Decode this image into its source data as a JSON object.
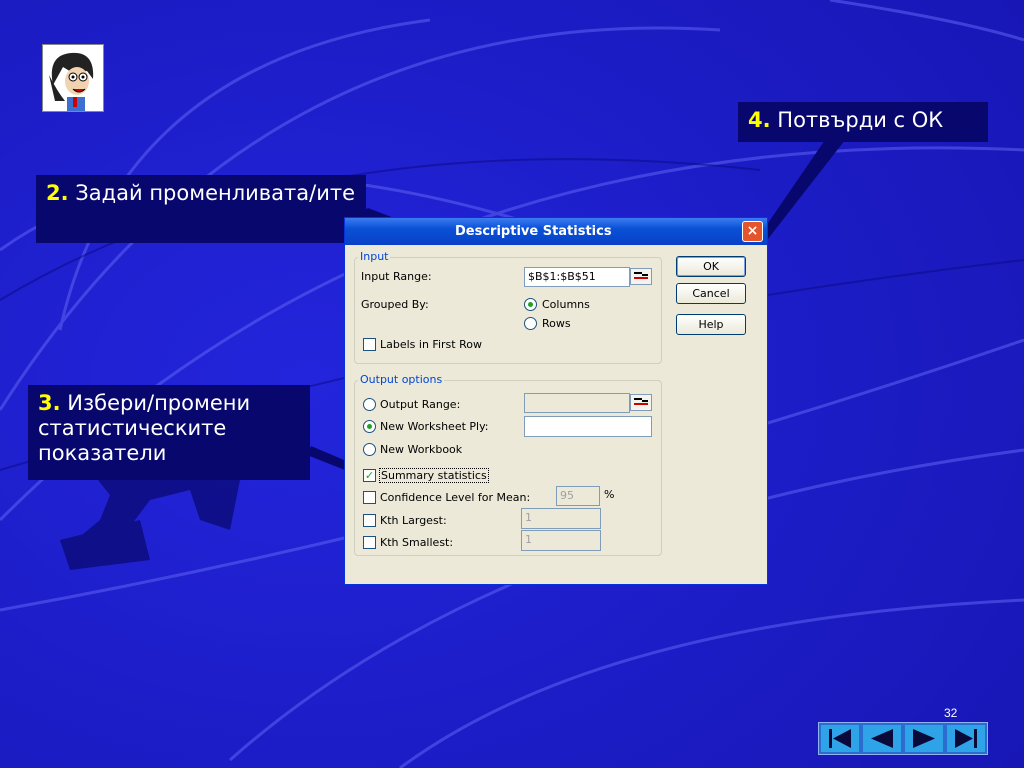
{
  "callouts": {
    "step2": {
      "num": "2.",
      "text": "Задай променливата/ите"
    },
    "step3": {
      "num": "3.",
      "text": "Избери/промени статистическите показатели"
    },
    "step4": {
      "num": "4.",
      "text": "Потвърди с ОК"
    }
  },
  "dialog": {
    "title": "Descriptive Statistics",
    "close_glyph": "×",
    "input_group": {
      "legend": "Input",
      "input_range_label": "Input Range:",
      "input_range_value": "$B$1:$B$51",
      "grouped_by_label": "Grouped By:",
      "columns_label": "Columns",
      "rows_label": "Rows",
      "labels_first_row": "Labels in First Row"
    },
    "output_group": {
      "legend": "Output options",
      "output_range_label": "Output Range:",
      "new_ply_label": "New Worksheet Ply:",
      "new_workbook_label": "New Workbook",
      "summary_label": "Summary statistics",
      "summary_checked": true,
      "confidence_label": "Confidence Level for Mean:",
      "confidence_value": "95",
      "percent": "%",
      "kth_largest_label": "Kth Largest:",
      "kth_largest_value": "1",
      "kth_smallest_label": "Kth Smallest:",
      "kth_smallest_value": "1"
    },
    "buttons": {
      "ok": "OK",
      "cancel": "Cancel",
      "help": "Help"
    }
  },
  "page_number": "32",
  "colors": {
    "background": "#1d1fcf",
    "callout": "#07076e",
    "step_number": "#ffff00"
  },
  "icons": [
    "teacher-cartoon-icon",
    "range-picker-icon",
    "first-slide-icon",
    "previous-slide-icon",
    "next-slide-icon",
    "last-slide-icon"
  ]
}
